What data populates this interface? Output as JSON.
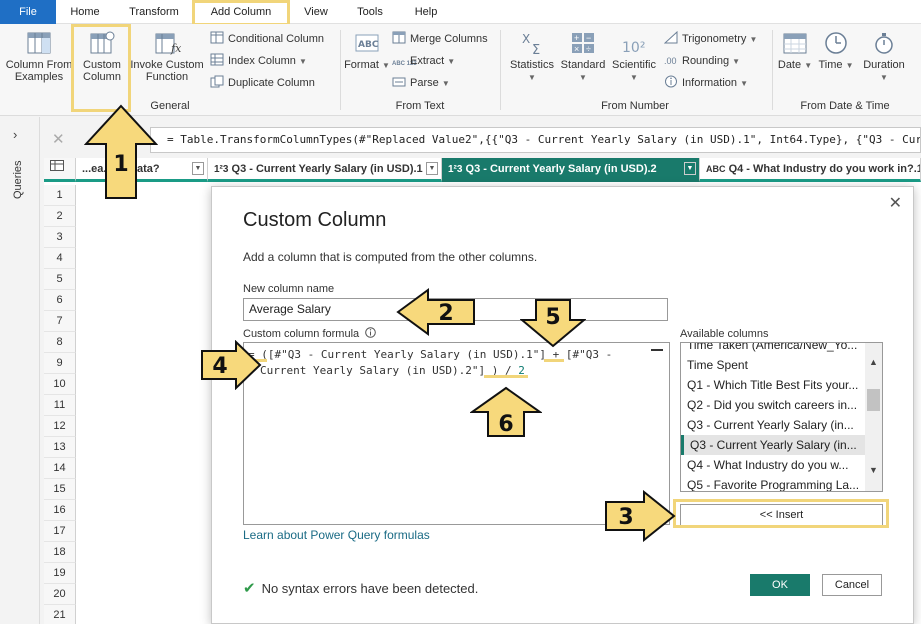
{
  "menu": {
    "file": "File",
    "home": "Home",
    "transform": "Transform",
    "add_column": "Add Column",
    "view": "View",
    "tools": "Tools",
    "help": "Help"
  },
  "ribbon": {
    "column_from_examples_1": "Column From",
    "column_from_examples_2": "Examples",
    "custom_column_1": "Custom",
    "custom_column_2": "Column",
    "invoke_custom_1": "Invoke Custom",
    "invoke_custom_2": "Function",
    "conditional_column": "Conditional Column",
    "index_column": "Index Column",
    "duplicate_column": "Duplicate Column",
    "group_general": "General",
    "format": "Format",
    "merge_columns": "Merge Columns",
    "extract": "Extract",
    "parse": "Parse",
    "group_from_text": "From Text",
    "statistics": "Statistics",
    "standard": "Standard",
    "scientific": "Scientific",
    "trigonometry": "Trigonometry",
    "rounding": "Rounding",
    "information": "Information",
    "group_from_number": "From Number",
    "date": "Date",
    "time": "Time",
    "duration": "Duration",
    "group_from_date_time": "From Date & Time",
    "abc_icon_text": "ABC",
    "abc123_icon_text": "ABC 123",
    "ten_squared": "10²"
  },
  "sidebar": {
    "queries_label": "Queries"
  },
  "formula_bar": {
    "fx": "fx",
    "text": "= Table.TransformColumnTypes(#\"Replaced Value2\",{{\"Q3 - Current Yearly Salary (in USD).1\", Int64.Type}, {\"Q3 - Curr"
  },
  "grid": {
    "columns": [
      {
        "type_icon": "",
        "label": "...ea... to Data?"
      },
      {
        "type_icon": "1²3",
        "label": "Q3 - Current Yearly Salary (in USD).1"
      },
      {
        "type_icon": "1²3",
        "label": "Q3 - Current Yearly Salary (in USD).2"
      },
      {
        "type_icon": "ABC",
        "label": "Q4 - What Industry do you work in?.1"
      }
    ],
    "rows": [
      "1",
      "2",
      "3",
      "4",
      "5",
      "6",
      "7",
      "8",
      "9",
      "10",
      "11",
      "12",
      "13",
      "14",
      "15",
      "16",
      "17",
      "18",
      "19",
      "20",
      "21"
    ]
  },
  "dialog": {
    "title": "Custom Column",
    "description": "Add a column that is computed from the other columns.",
    "new_column_name_label": "New column name",
    "new_column_name_value": "Average Salary",
    "formula_label": "Custom column formula",
    "formula_line1_a": "= ([#\"Q3 - Current Yearly Salary (in USD).1\"] + [#\"Q3 -",
    "formula_line2_a": "Current Yearly Salary (in USD).2\"] ) / ",
    "formula_line2_num": "2",
    "available_label": "Available columns",
    "available_columns": [
      "Time Taken (America/New_Yo...",
      "Time Spent",
      "Q1 - Which Title Best Fits your...",
      "Q2 - Did you switch careers in...",
      "Q3 - Current Yearly Salary (in...",
      "Q3 - Current Yearly Salary (in...",
      "Q4 - What Industry do you w...",
      "Q5 - Favorite Programming La..."
    ],
    "insert_button": "<< Insert",
    "learn_link": "Learn about Power Query formulas",
    "status_text": "No syntax errors have been detected.",
    "ok_button": "OK",
    "cancel_button": "Cancel"
  },
  "callouts": [
    "1",
    "2",
    "3",
    "4",
    "5",
    "6"
  ],
  "colors": {
    "accent_green": "#197a6b",
    "highlight_yellow": "#f1d57a",
    "callout_fill": "#f7d97c",
    "file_blue": "#1f6fc5"
  }
}
